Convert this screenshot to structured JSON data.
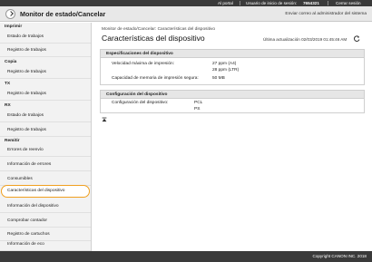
{
  "topbar": {
    "portal": "Al portal",
    "login_user_label": "Usuario de inicio de sesión:",
    "login_user_value": "7654321",
    "logout": "Cerrar sesión"
  },
  "header": {
    "title": "Monitor de estado/Cancelar",
    "admin_mail": "Enviar correo al administrador del sistema"
  },
  "sidebar": {
    "sections": [
      {
        "title": "Imprimir",
        "items": [
          "Estado de trabajos",
          "Registro de trabajos"
        ]
      },
      {
        "title": "Copia",
        "items": [
          "Registro de trabajos"
        ]
      },
      {
        "title": "TX",
        "items": [
          "Registro de trabajos"
        ]
      },
      {
        "title": "RX",
        "items": [
          "Estado de trabajos",
          "Registro de trabajos"
        ]
      },
      {
        "title": "Remitir",
        "items": [
          "Errores de reenvío",
          "Información de errores",
          "Consumibles",
          "Características del dispositivo",
          "Información del dispositivo",
          "Comprobar contador",
          "Registro de cartuchos",
          "Información de eco"
        ]
      }
    ]
  },
  "main": {
    "breadcrumb": "Monitor de estado/Cancelar: Características del dispositivo",
    "title": "Características del dispositivo",
    "last_update": "Última actualización 02/03/2019 01:45:46 AM",
    "specs": {
      "heading": "Especificaciones del dispositivo",
      "speed_label": "Velocidad máxima de impresión:",
      "speed_a4": "27 ppm (A4)",
      "speed_ltr": "28 ppm (LTR)",
      "memory_label": "Capacidad de memoria de impresión segura:",
      "memory_value": "50 MB"
    },
    "config": {
      "heading": "Configuración del dispositivo",
      "label": "Configuración del dispositivo:",
      "value1": "PCL",
      "value2": "PS"
    }
  },
  "footer": {
    "copyright": "Copyright CANON INC. 2018"
  }
}
